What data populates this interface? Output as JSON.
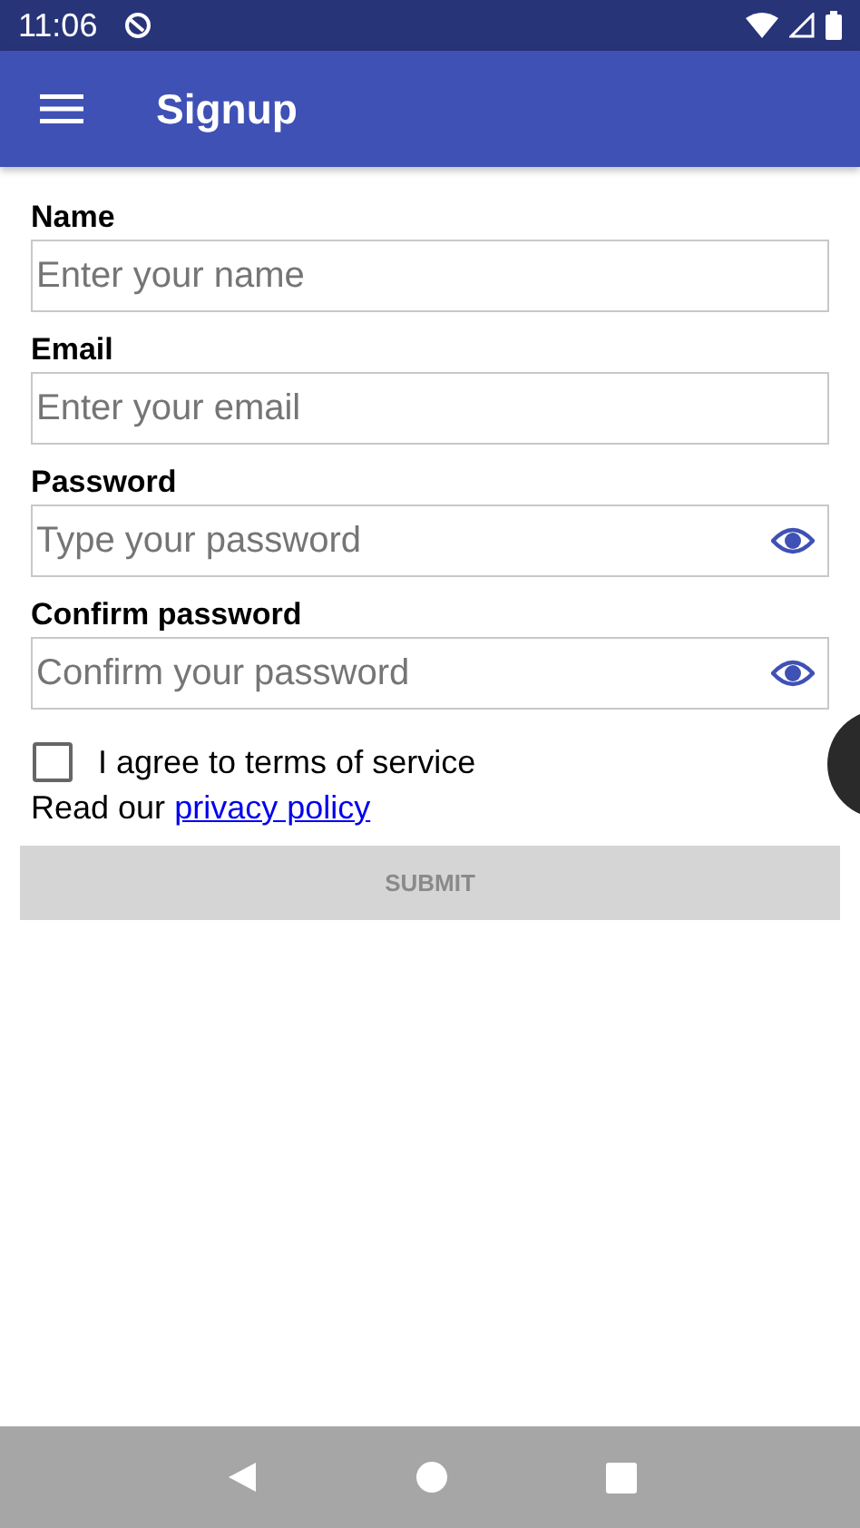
{
  "status_bar": {
    "time": "11:06"
  },
  "app_bar": {
    "title": "Signup"
  },
  "fields": [
    {
      "label": "Name",
      "placeholder": "Enter your name",
      "kind": "text"
    },
    {
      "label": "Email",
      "placeholder": "Enter your email",
      "kind": "text"
    },
    {
      "label": "Password",
      "placeholder": "Type your password",
      "kind": "password"
    },
    {
      "label": "Confirm password",
      "placeholder": "Confirm your password",
      "kind": "password"
    }
  ],
  "terms": {
    "label": "I agree to terms of service",
    "checked": false
  },
  "privacy": {
    "text": "Read our",
    "link": "privacy policy"
  },
  "submit": {
    "label": "SUBMIT",
    "disabled": true
  }
}
